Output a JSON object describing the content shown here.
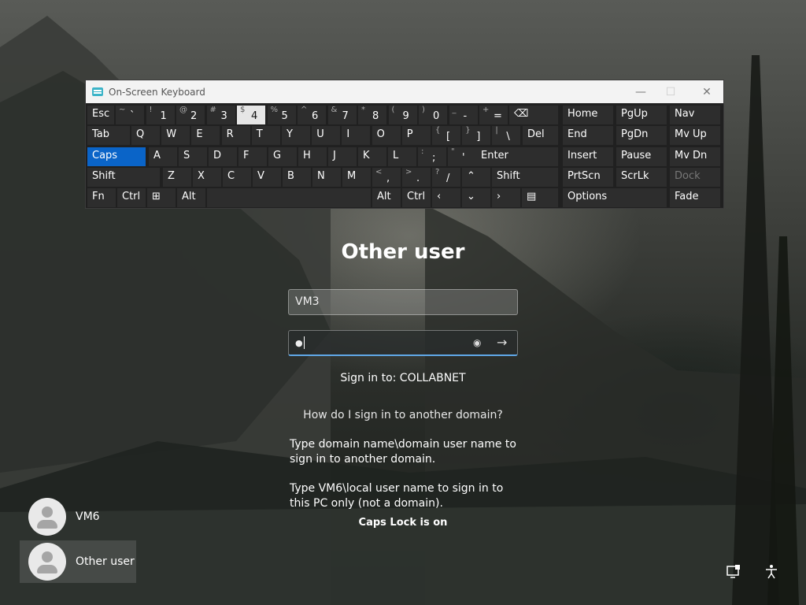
{
  "osk": {
    "title": "On-Screen Keyboard",
    "row1": [
      {
        "label": "Esc"
      },
      {
        "shift": "~",
        "main": "`"
      },
      {
        "shift": "!",
        "main": "1"
      },
      {
        "shift": "@",
        "main": "2"
      },
      {
        "shift": "#",
        "main": "3"
      },
      {
        "shift": "$",
        "main": "4"
      },
      {
        "shift": "%",
        "main": "5"
      },
      {
        "shift": "^",
        "main": "6"
      },
      {
        "shift": "&",
        "main": "7"
      },
      {
        "shift": "*",
        "main": "8"
      },
      {
        "shift": "(",
        "main": "9"
      },
      {
        "shift": ")",
        "main": "0"
      },
      {
        "shift": "_",
        "main": "-"
      },
      {
        "shift": "+",
        "main": "="
      }
    ],
    "row2": [
      "Tab",
      "Q",
      "W",
      "E",
      "R",
      "T",
      "Y",
      "U",
      "I",
      "O",
      "P"
    ],
    "row2_sym": [
      {
        "shift": "{",
        "main": "["
      },
      {
        "shift": "}",
        "main": "]"
      },
      {
        "shift": "|",
        "main": "\\"
      }
    ],
    "row2_del": "Del",
    "row3": [
      "Caps",
      "A",
      "S",
      "D",
      "F",
      "G",
      "H",
      "J",
      "K",
      "L"
    ],
    "row3_sym": [
      {
        "shift": ":",
        "main": ";"
      },
      {
        "shift": "\"",
        "main": "'"
      }
    ],
    "row3_enter": "Enter",
    "row4": [
      "Shift",
      "Z",
      "X",
      "C",
      "V",
      "B",
      "N",
      "M"
    ],
    "row4_sym": [
      {
        "shift": "<",
        "main": ","
      },
      {
        "shift": ">",
        "main": "."
      },
      {
        "shift": "?",
        "main": "/"
      }
    ],
    "row4_shift": "Shift",
    "row5": {
      "fn": "Fn",
      "ctrl": "Ctrl",
      "alt": "Alt",
      "alt_r": "Alt",
      "ctrl_r": "Ctrl"
    },
    "nav": [
      "Home",
      "PgUp",
      "Nav",
      "End",
      "PgDn",
      "Mv Up",
      "Insert",
      "Pause",
      "Mv Dn",
      "PrtScn",
      "ScrLk",
      "Dock",
      "Options",
      "Fade"
    ]
  },
  "login": {
    "title": "Other user",
    "username_value": "VM3",
    "password_mask": "●",
    "sign_in_to": "Sign in to: COLLABNET",
    "help_link": "How do I sign in to another domain?",
    "help_text_1": "Type domain name\\domain user name to sign in to another domain.",
    "help_text_2": "Type VM6\\local user name to sign in to this PC only (not a domain).",
    "caps_warning": "Caps Lock is on"
  },
  "users": [
    {
      "name": "VM6"
    },
    {
      "name": "Other user"
    }
  ],
  "icons": {
    "network": "network-icon",
    "accessibility": "accessibility-icon"
  }
}
